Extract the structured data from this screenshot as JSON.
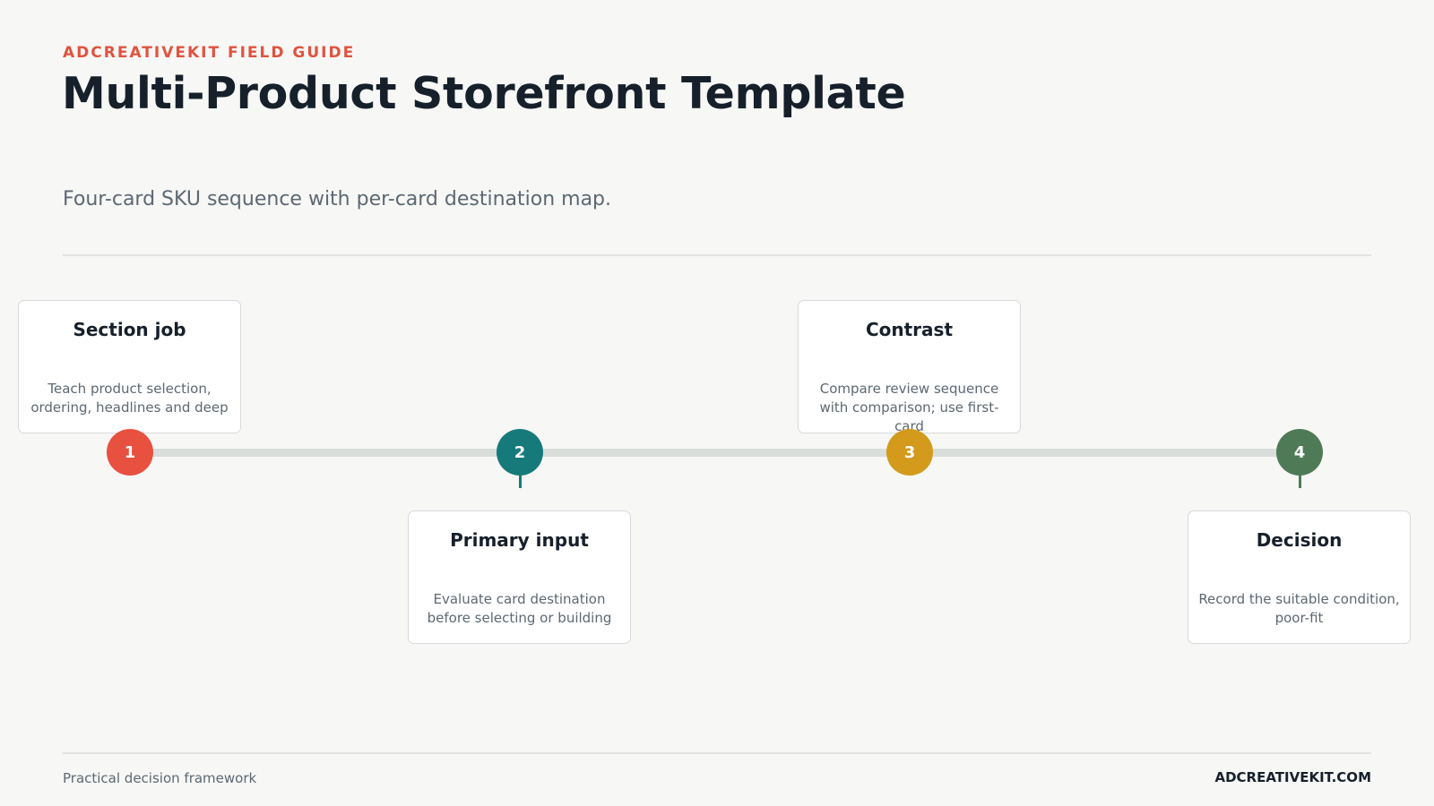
{
  "header": {
    "eyebrow": "ADCREATIVEKIT FIELD GUIDE",
    "title": "Multi-Product Storefront Template",
    "subtitle": "Four-card SKU sequence with per-card destination map."
  },
  "steps": [
    {
      "number": "1",
      "title": "Section job",
      "body": "Teach product selection, ordering, headlines and deep",
      "color": "#e8503f",
      "position": "above"
    },
    {
      "number": "2",
      "title": "Primary input",
      "body": "Evaluate card destination before selecting or building",
      "color": "#177a7a",
      "position": "below"
    },
    {
      "number": "3",
      "title": "Contrast",
      "body": "Compare review sequence with comparison; use first-card",
      "color": "#d39a1c",
      "position": "above"
    },
    {
      "number": "4",
      "title": "Decision",
      "body": "Record the suitable condition, poor-fit",
      "color": "#4e7a56",
      "position": "below"
    }
  ],
  "footer": {
    "left": "Practical decision framework",
    "right": "ADCREATIVEKIT.COM"
  }
}
